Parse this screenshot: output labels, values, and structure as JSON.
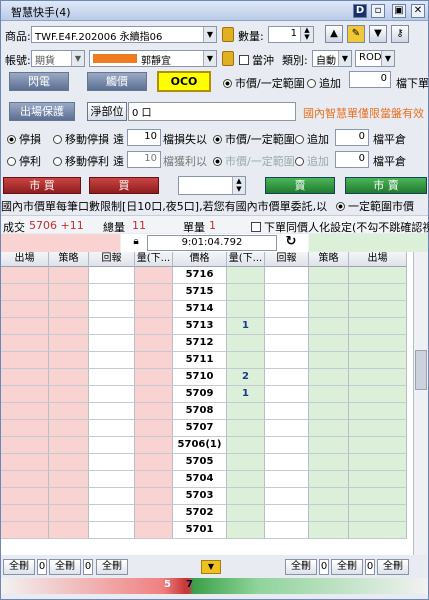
{
  "window": {
    "title": "智慧快手(4)"
  },
  "titlebar": {
    "icons": [
      "d-icon",
      "restore-icon",
      "pin-icon",
      "close-icon"
    ],
    "icon_glyphs": [
      "D",
      "▫",
      "▣",
      "✕"
    ]
  },
  "row1": {
    "product_label": "商品:",
    "product_value": "TWF.E4F.202006 永續指06",
    "qty_label": "數量:",
    "qty_value": "1"
  },
  "row2": {
    "account_label": "帳號:",
    "account_type": "期貨",
    "account_name": "郭靜宜",
    "hedge_label": "當沖",
    "category_label": "類別:",
    "category_value": "自動",
    "order_type": "ROD"
  },
  "row3": {
    "flash_btn": "閃電",
    "touch_btn": "觸價",
    "oco_btn": "OCO",
    "opt_market": "市價/一定範圍",
    "opt_chase": "追加",
    "chase_value": "0",
    "right_label": "檔下單"
  },
  "row4": {
    "exit_btn": "出場保護",
    "net_label": "淨部位",
    "net_value": "0 口",
    "warn_text": "國內智慧單僅限當盤有效"
  },
  "row5": {
    "stoploss": "停損",
    "moving_stoploss": "移動停損",
    "far": "遠",
    "loss_ticks": "10",
    "loss_label": "檔損失以",
    "opt_market": "市價/一定範圍",
    "opt_chase": "追加",
    "chase_value": "0",
    "flat_label": "檔平倉"
  },
  "row6": {
    "takeprofit": "停利",
    "moving_takeprofit": "移動停利",
    "far": "遠",
    "profit_ticks": "10",
    "profit_label": "檔獲利以",
    "opt_market": "市價/一定範圍",
    "opt_chase": "追加",
    "chase_value": "0",
    "flat_label": "檔平倉"
  },
  "row7": {
    "mkt_buy": "市 買",
    "buy": "買",
    "sell": "賣",
    "mkt_sell": "市 賣",
    "opt_range": "一定範圍市價"
  },
  "notice": "國內市價單每筆口數限制[日10口,夜5口],若您有國內市價單委託,以",
  "stats": {
    "deal_label": "成交",
    "deal_value": "5706 +11",
    "vol_label": "總量",
    "vol_value": "11",
    "count_label": "單量",
    "count_value": "1",
    "human_label": "下單同價人化設定(不勾不跳確認視"
  },
  "time": "9:01:04.792",
  "columns": [
    "出場",
    "策略",
    "回報",
    "量(下...",
    "價格",
    "量(下...",
    "回報",
    "策略",
    "出場"
  ],
  "rows": [
    {
      "price": "5716",
      "bid": "",
      "ask": ""
    },
    {
      "price": "5715",
      "bid": "",
      "ask": ""
    },
    {
      "price": "5714",
      "bid": "",
      "ask": ""
    },
    {
      "price": "5713",
      "bid": "",
      "ask": "1"
    },
    {
      "price": "5712",
      "bid": "",
      "ask": ""
    },
    {
      "price": "5711",
      "bid": "",
      "ask": ""
    },
    {
      "price": "5710",
      "bid": "",
      "ask": "2"
    },
    {
      "price": "5709",
      "bid": "",
      "ask": "1"
    },
    {
      "price": "5708",
      "bid": "",
      "ask": ""
    },
    {
      "price": "5707",
      "bid": "",
      "ask": ""
    },
    {
      "price": "5706(1)",
      "bid": "",
      "ask": ""
    },
    {
      "price": "5705",
      "bid": "",
      "ask": ""
    },
    {
      "price": "5704",
      "bid": "",
      "ask": ""
    },
    {
      "price": "5703",
      "bid": "",
      "ask": ""
    },
    {
      "price": "5702",
      "bid": "",
      "ask": ""
    },
    {
      "price": "5701",
      "bid": "",
      "ask": ""
    }
  ],
  "bottom": {
    "all_del": "全刪",
    "zero": "0"
  },
  "status": {
    "left": "5",
    "right": "7"
  },
  "colors": {
    "pink": "#f9d2d2",
    "green": "#dcefd9",
    "buy_red": "#c0302b",
    "sell_green": "#2f9a3c",
    "oco_yellow": "#ffff00"
  }
}
